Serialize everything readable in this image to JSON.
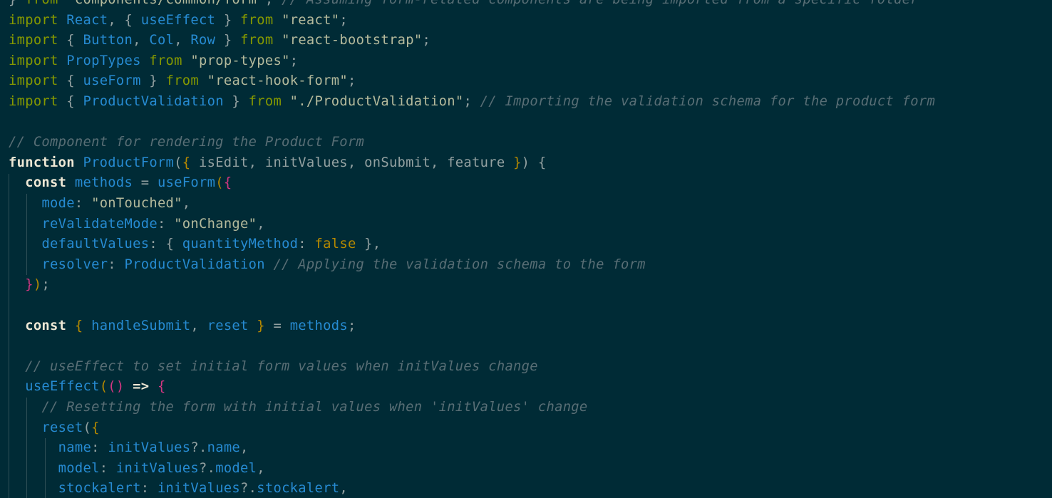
{
  "editor": {
    "theme_colors": {
      "background": "#002b36",
      "keyword": "#859900",
      "identifier": "#268bd2",
      "string": "#b4ba9c",
      "comment": "#586e75",
      "bracket": "#b58900",
      "bracket_alt": "#d33682"
    },
    "lines": [
      [
        {
          "t": "} ",
          "c": "plain"
        },
        {
          "t": "from",
          "c": "kw"
        },
        {
          "t": " \"components/common/form\"",
          "c": "str"
        },
        {
          "t": "; ",
          "c": "plain"
        },
        {
          "t": "// Assuming form-related components are being imported from a specific folder",
          "c": "cmt"
        }
      ],
      [
        {
          "t": "import",
          "c": "kw"
        },
        {
          "t": " ",
          "c": "plain"
        },
        {
          "t": "React",
          "c": "id"
        },
        {
          "t": ", { ",
          "c": "plain"
        },
        {
          "t": "useEffect",
          "c": "id"
        },
        {
          "t": " } ",
          "c": "plain"
        },
        {
          "t": "from",
          "c": "kw"
        },
        {
          "t": " \"react\"",
          "c": "str"
        },
        {
          "t": ";",
          "c": "plain"
        }
      ],
      [
        {
          "t": "import",
          "c": "kw"
        },
        {
          "t": " { ",
          "c": "plain"
        },
        {
          "t": "Button",
          "c": "id"
        },
        {
          "t": ", ",
          "c": "plain"
        },
        {
          "t": "Col",
          "c": "id"
        },
        {
          "t": ", ",
          "c": "plain"
        },
        {
          "t": "Row",
          "c": "id"
        },
        {
          "t": " } ",
          "c": "plain"
        },
        {
          "t": "from",
          "c": "kw"
        },
        {
          "t": " \"react-bootstrap\"",
          "c": "str"
        },
        {
          "t": ";",
          "c": "plain"
        }
      ],
      [
        {
          "t": "import",
          "c": "kw"
        },
        {
          "t": " ",
          "c": "plain"
        },
        {
          "t": "PropTypes",
          "c": "id"
        },
        {
          "t": " ",
          "c": "plain"
        },
        {
          "t": "from",
          "c": "kw"
        },
        {
          "t": " \"prop-types\"",
          "c": "str"
        },
        {
          "t": ";",
          "c": "plain"
        }
      ],
      [
        {
          "t": "import",
          "c": "kw"
        },
        {
          "t": " { ",
          "c": "plain"
        },
        {
          "t": "useForm",
          "c": "id"
        },
        {
          "t": " } ",
          "c": "plain"
        },
        {
          "t": "from",
          "c": "kw"
        },
        {
          "t": " \"react-hook-form\"",
          "c": "str"
        },
        {
          "t": ";",
          "c": "plain"
        }
      ],
      [
        {
          "t": "import",
          "c": "kw"
        },
        {
          "t": " { ",
          "c": "plain"
        },
        {
          "t": "ProductValidation",
          "c": "id"
        },
        {
          "t": " } ",
          "c": "plain"
        },
        {
          "t": "from",
          "c": "kw"
        },
        {
          "t": " \"./ProductValidation\"",
          "c": "str"
        },
        {
          "t": "; ",
          "c": "plain"
        },
        {
          "t": "// Importing the validation schema for the product form",
          "c": "cmt"
        }
      ],
      [],
      [
        {
          "t": "// Component for rendering the Product Form",
          "c": "cmt"
        }
      ],
      [
        {
          "t": "function",
          "c": "bold"
        },
        {
          "t": " ",
          "c": "plain"
        },
        {
          "t": "ProductForm",
          "c": "id"
        },
        {
          "t": "(",
          "c": "plain"
        },
        {
          "t": "{",
          "c": "br"
        },
        {
          "t": " isEdit, initValues, onSubmit, feature ",
          "c": "plain"
        },
        {
          "t": "}",
          "c": "br"
        },
        {
          "t": ") {",
          "c": "plain"
        }
      ],
      [
        {
          "t": "  ",
          "c": "plain"
        },
        {
          "t": "const",
          "c": "bold"
        },
        {
          "t": " ",
          "c": "plain"
        },
        {
          "t": "methods",
          "c": "id"
        },
        {
          "t": " = ",
          "c": "plain"
        },
        {
          "t": "useForm",
          "c": "id"
        },
        {
          "t": "(",
          "c": "br"
        },
        {
          "t": "{",
          "c": "br2"
        }
      ],
      [
        {
          "t": "    ",
          "c": "plain"
        },
        {
          "t": "mode",
          "c": "id"
        },
        {
          "t": ": ",
          "c": "plain"
        },
        {
          "t": "\"onTouched\"",
          "c": "str"
        },
        {
          "t": ",",
          "c": "plain"
        }
      ],
      [
        {
          "t": "    ",
          "c": "plain"
        },
        {
          "t": "reValidateMode",
          "c": "id"
        },
        {
          "t": ": ",
          "c": "plain"
        },
        {
          "t": "\"onChange\"",
          "c": "str"
        },
        {
          "t": ",",
          "c": "plain"
        }
      ],
      [
        {
          "t": "    ",
          "c": "plain"
        },
        {
          "t": "defaultValues",
          "c": "id"
        },
        {
          "t": ": { ",
          "c": "plain"
        },
        {
          "t": "quantityMethod",
          "c": "id"
        },
        {
          "t": ": ",
          "c": "plain"
        },
        {
          "t": "false",
          "c": "bool"
        },
        {
          "t": " },",
          "c": "plain"
        }
      ],
      [
        {
          "t": "    ",
          "c": "plain"
        },
        {
          "t": "resolver",
          "c": "id"
        },
        {
          "t": ": ",
          "c": "plain"
        },
        {
          "t": "ProductValidation",
          "c": "id"
        },
        {
          "t": " ",
          "c": "plain"
        },
        {
          "t": "// Applying the validation schema to the form",
          "c": "cmt"
        }
      ],
      [
        {
          "t": "  ",
          "c": "plain"
        },
        {
          "t": "}",
          "c": "br2"
        },
        {
          "t": ")",
          "c": "br"
        },
        {
          "t": ";",
          "c": "plain"
        }
      ],
      [],
      [
        {
          "t": "  ",
          "c": "plain"
        },
        {
          "t": "const",
          "c": "bold"
        },
        {
          "t": " ",
          "c": "plain"
        },
        {
          "t": "{",
          "c": "br"
        },
        {
          "t": " ",
          "c": "plain"
        },
        {
          "t": "handleSubmit",
          "c": "id"
        },
        {
          "t": ", ",
          "c": "plain"
        },
        {
          "t": "reset",
          "c": "id"
        },
        {
          "t": " ",
          "c": "plain"
        },
        {
          "t": "}",
          "c": "br"
        },
        {
          "t": " = ",
          "c": "plain"
        },
        {
          "t": "methods",
          "c": "id"
        },
        {
          "t": ";",
          "c": "plain"
        }
      ],
      [],
      [
        {
          "t": "  ",
          "c": "plain"
        },
        {
          "t": "// useEffect to set initial form values when initValues change",
          "c": "cmt"
        }
      ],
      [
        {
          "t": "  ",
          "c": "plain"
        },
        {
          "t": "useEffect",
          "c": "id"
        },
        {
          "t": "(",
          "c": "br"
        },
        {
          "t": "()",
          "c": "br2"
        },
        {
          "t": " ",
          "c": "plain"
        },
        {
          "t": "=>",
          "c": "bold"
        },
        {
          "t": " ",
          "c": "plain"
        },
        {
          "t": "{",
          "c": "br2"
        }
      ],
      [
        {
          "t": "    ",
          "c": "plain"
        },
        {
          "t": "// Resetting the form with initial values when 'initValues' change",
          "c": "cmt"
        }
      ],
      [
        {
          "t": "    ",
          "c": "plain"
        },
        {
          "t": "reset",
          "c": "id"
        },
        {
          "t": "(",
          "c": "plain"
        },
        {
          "t": "{",
          "c": "br"
        }
      ],
      [
        {
          "t": "      ",
          "c": "plain"
        },
        {
          "t": "name",
          "c": "id"
        },
        {
          "t": ": ",
          "c": "plain"
        },
        {
          "t": "initValues",
          "c": "id"
        },
        {
          "t": "?.",
          "c": "plain"
        },
        {
          "t": "name",
          "c": "id"
        },
        {
          "t": ",",
          "c": "plain"
        }
      ],
      [
        {
          "t": "      ",
          "c": "plain"
        },
        {
          "t": "model",
          "c": "id"
        },
        {
          "t": ": ",
          "c": "plain"
        },
        {
          "t": "initValues",
          "c": "id"
        },
        {
          "t": "?.",
          "c": "plain"
        },
        {
          "t": "model",
          "c": "id"
        },
        {
          "t": ",",
          "c": "plain"
        }
      ],
      [
        {
          "t": "      ",
          "c": "plain"
        },
        {
          "t": "stockalert",
          "c": "id"
        },
        {
          "t": ": ",
          "c": "plain"
        },
        {
          "t": "initValues",
          "c": "id"
        },
        {
          "t": "?.",
          "c": "plain"
        },
        {
          "t": "stockalert",
          "c": "id"
        },
        {
          "t": ",",
          "c": "plain"
        }
      ]
    ]
  }
}
